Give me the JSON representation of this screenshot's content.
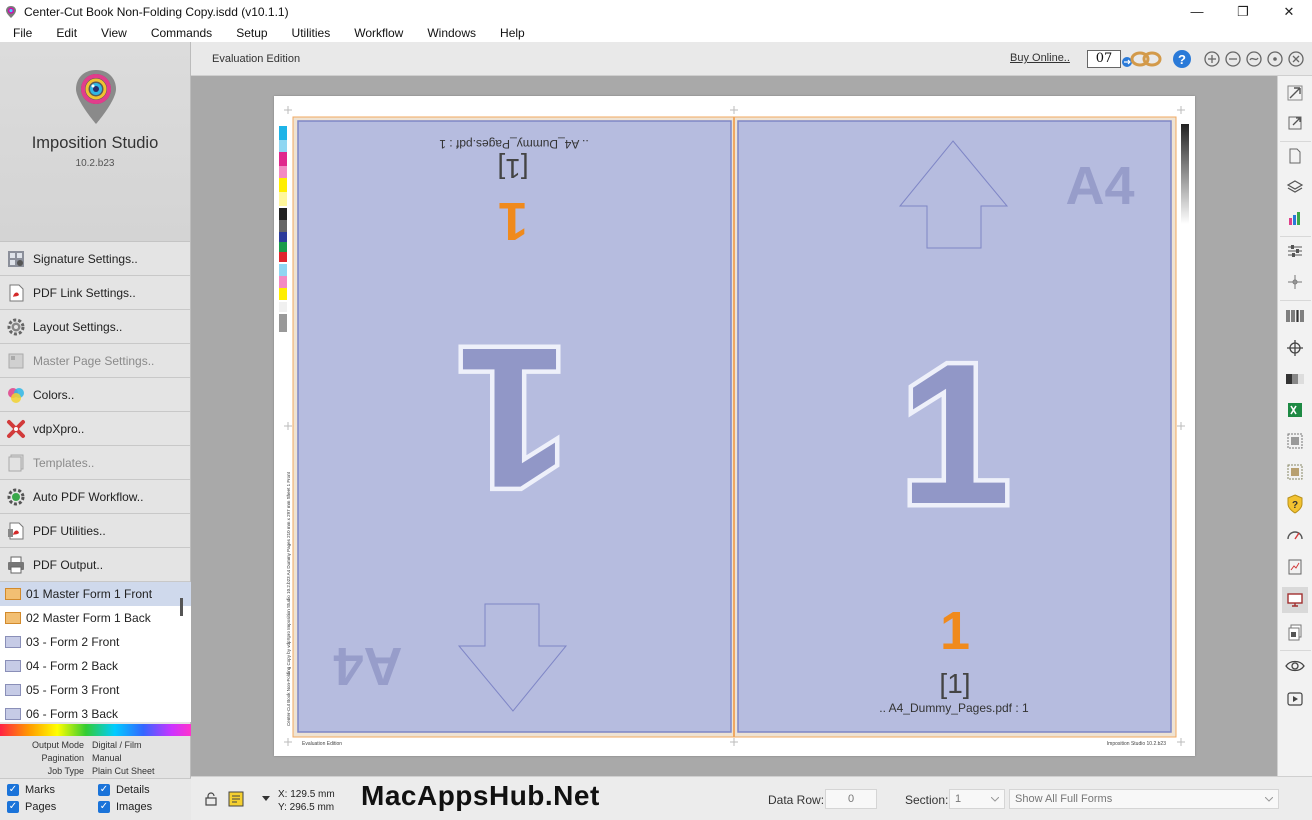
{
  "window": {
    "title": "Center-Cut Book Non-Folding Copy.isdd (v10.1.1)",
    "minimize": "—",
    "maximize": "❐",
    "close": "✕"
  },
  "menu": [
    "File",
    "Edit",
    "View",
    "Commands",
    "Setup",
    "Utilities",
    "Workflow",
    "Windows",
    "Help"
  ],
  "sidebar": {
    "app_name": "Imposition Studio",
    "app_version": "10.2.b23",
    "buttons": [
      {
        "label": "Signature Settings..",
        "icon": "signature-settings-icon",
        "enabled": true
      },
      {
        "label": "PDF Link Settings..",
        "icon": "pdf-link-icon",
        "enabled": true
      },
      {
        "label": "Layout Settings..",
        "icon": "gear-icon",
        "enabled": true
      },
      {
        "label": "Master Page Settings..",
        "icon": "master-page-icon",
        "enabled": false
      },
      {
        "label": "Colors..",
        "icon": "colors-icon",
        "enabled": true
      },
      {
        "label": "vdpXpro..",
        "icon": "vdpxpro-icon",
        "enabled": true
      },
      {
        "label": "Templates..",
        "icon": "templates-icon",
        "enabled": false
      },
      {
        "label": "Auto PDF Workflow..",
        "icon": "workflow-gear-icon",
        "enabled": true
      },
      {
        "label": "PDF Utilities..",
        "icon": "pdf-utilities-icon",
        "enabled": true
      },
      {
        "label": "PDF Output..",
        "icon": "printer-icon",
        "enabled": true
      }
    ],
    "forms": [
      {
        "label": "01 Master Form 1 Front",
        "selected": true,
        "master": true
      },
      {
        "label": "02 Master Form 1 Back",
        "selected": false,
        "master": true
      },
      {
        "label": "03 - Form 2 Front",
        "selected": false,
        "master": false
      },
      {
        "label": "04 - Form 2 Back",
        "selected": false,
        "master": false
      },
      {
        "label": "05 - Form 3 Front",
        "selected": false,
        "master": false
      },
      {
        "label": "06 - Form 3 Back",
        "selected": false,
        "master": false
      }
    ],
    "info": {
      "output_mode_label": "Output Mode",
      "output_mode_value": "Digital / Film",
      "pagination_label": "Pagination",
      "pagination_value": "Manual",
      "job_type_label": "Job Type",
      "job_type_value": "Plain Cut Sheet"
    },
    "checks": {
      "marks": "Marks",
      "details": "Details",
      "pages": "Pages",
      "images": "Images"
    }
  },
  "doc_header": {
    "edition": "Evaluation Edition",
    "buy": "Buy Online..",
    "counter": "07"
  },
  "sheet": {
    "left_page": {
      "file_label": ".. A4_Dummy_Pages.pdf : 1",
      "bracket_num": "[1]",
      "orange_num": "1",
      "big_num": "1",
      "size": "A4"
    },
    "right_page": {
      "file_label": ".. A4_Dummy_Pages.pdf : 1",
      "bracket_num": "[1]",
      "orange_num": "1",
      "big_num": "1",
      "size": "A4"
    },
    "footer_left": "Evaluation Edition",
    "footer_right": "Imposition Studio 10.2.b23"
  },
  "status": {
    "x": "X: 129.5 mm",
    "y": "Y: 296.5 mm",
    "watermark": "MacAppsHub.Net",
    "data_row_label": "Data Row:",
    "data_row_value": "0",
    "section_label": "Section:",
    "section_value": "1",
    "show_forms": "Show All Full Forms"
  },
  "colors": {
    "page_fill": "#b6bcdf",
    "page_border": "#7f86c6",
    "orange": "#f08a1c",
    "sidebar_bg": "#e3e3e3",
    "canvas_bg": "#a9a9a9"
  }
}
